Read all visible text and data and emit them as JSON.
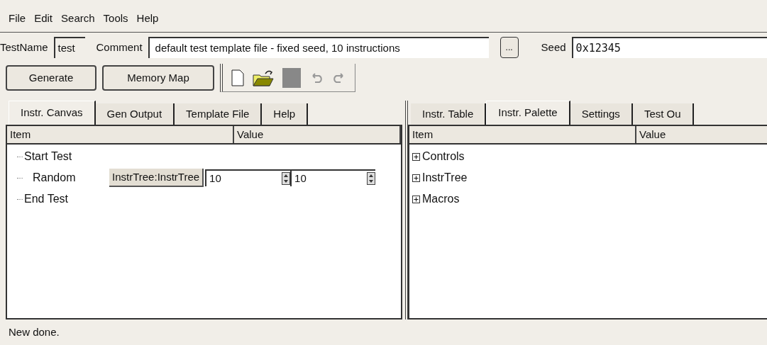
{
  "menu": [
    "File",
    "Edit",
    "Search",
    "Tools",
    "Help"
  ],
  "fields": {
    "testname_label": "TestName",
    "testname": "test",
    "comment_label": "Comment",
    "comment": "default test template file - fixed seed, 10 instructions",
    "browse": "...",
    "seed_label": "Seed",
    "seed": "0x12345"
  },
  "buttons": [
    "Generate",
    "Memory Map"
  ],
  "left_tabs": [
    {
      "label": "Instr. Canvas",
      "selected": true
    },
    {
      "label": "Gen Output",
      "selected": false
    },
    {
      "label": "Template File",
      "selected": false
    },
    {
      "label": "Help",
      "selected": false
    }
  ],
  "left_table": {
    "columns": [
      "Item",
      "Value"
    ],
    "rows": [
      {
        "kind": "plain",
        "item": "Start Test"
      },
      {
        "kind": "random",
        "item": "Random",
        "tree": "InstrTree:InstrTree",
        "min": "10",
        "max": "10"
      },
      {
        "kind": "plain",
        "item": "End Test"
      }
    ]
  },
  "right_tabs": [
    {
      "label": "Instr. Table",
      "selected": false
    },
    {
      "label": "Instr. Palette",
      "selected": true
    },
    {
      "label": "Settings",
      "selected": false
    },
    {
      "label": "Test Ou",
      "selected": false
    }
  ],
  "right_table": {
    "columns": [
      "Item",
      "Value"
    ],
    "rows": [
      {
        "item": "Controls",
        "expanded": false
      },
      {
        "item": "InstrTree",
        "expanded": false
      },
      {
        "item": "Macros",
        "expanded": false
      }
    ]
  },
  "status_bar": "New done."
}
